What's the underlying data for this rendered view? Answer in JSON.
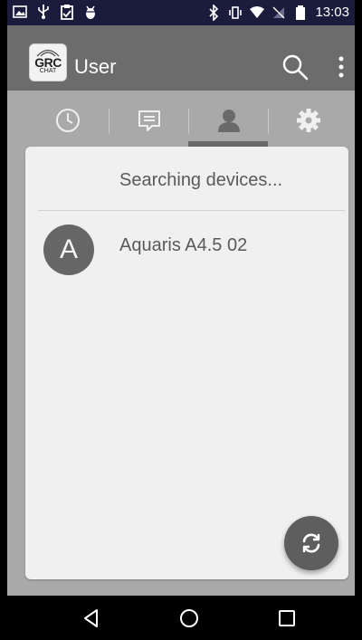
{
  "status_bar": {
    "time": "13:03",
    "icons": [
      "image-icon",
      "usb-icon",
      "clipboard-icon",
      "android-debug-icon",
      "bluetooth-icon",
      "vibrate-icon",
      "wifi-icon",
      "no-sim-icon",
      "battery-icon"
    ]
  },
  "app_bar": {
    "logo_text": "GRC",
    "logo_subtext": "CHAT",
    "title": "User",
    "actions": [
      "search-icon",
      "more-vertical-icon"
    ]
  },
  "tabs": [
    {
      "icon": "clock-icon",
      "selected": false
    },
    {
      "icon": "chat-icon",
      "selected": false
    },
    {
      "icon": "user-icon",
      "selected": true
    },
    {
      "icon": "gear-icon",
      "selected": false
    }
  ],
  "content": {
    "status_text": "Searching devices...",
    "devices": [
      {
        "initial": "A",
        "name": "Aquaris A4.5 02"
      }
    ],
    "fab_icon": "refresh-icon"
  },
  "nav_bar": {
    "buttons": [
      "back-icon",
      "home-icon",
      "recents-icon"
    ]
  },
  "colors": {
    "status_bar": "#1b1b3b",
    "app_bar": "#6c6c6c",
    "background": "#a9a9a9",
    "card": "#f0f0f0",
    "fab": "#5e5e5e"
  }
}
